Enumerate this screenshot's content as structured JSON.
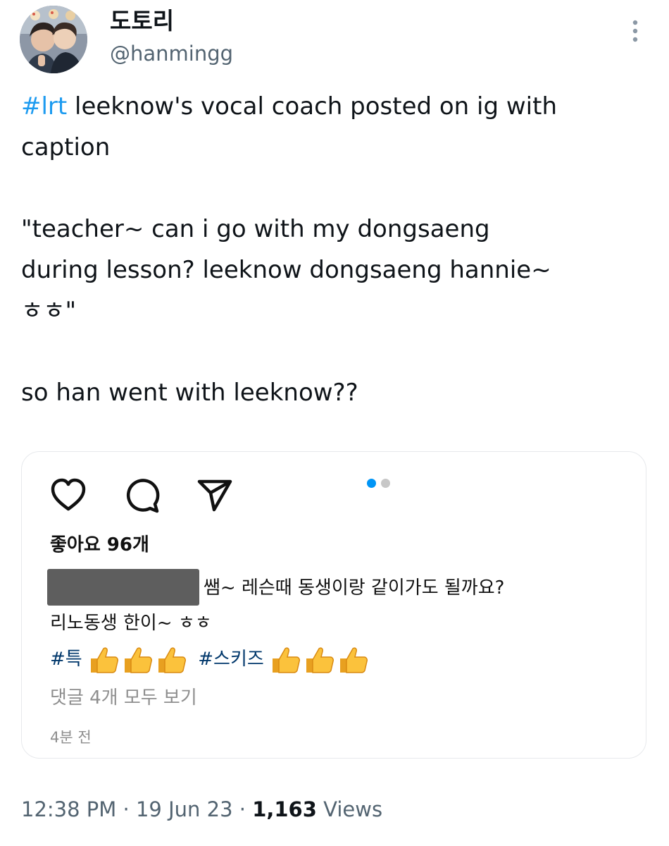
{
  "tweet": {
    "author": {
      "display_name": "도토리",
      "handle": "@hanmingg"
    },
    "text": {
      "hashtag": "#lrt",
      "line1_rest": " leeknow's vocal coach posted on ig with",
      "line2": "caption",
      "quote_line1": "\"teacher~ can i go with my dongsaeng",
      "quote_line2": "during lesson? leeknow dongsaeng hannie~",
      "quote_line3": "ㅎㅎ\"",
      "closing": "so han went with leeknow??"
    },
    "embedded_post": {
      "likes": "좋아요 96개",
      "caption_line1": "쌤~ 레슨때 동생이랑 같이가도 될까요?",
      "caption_line2": "리노동생 한이~ ㅎㅎ",
      "tag1": "#특",
      "tag2": "#스키즈",
      "thumbs_emoji_count": 3,
      "view_comments": "댓글 4개 모두 보기",
      "time_ago": "4분 전",
      "carousel": {
        "total": 2,
        "active": 1
      },
      "icons": [
        "heart-icon",
        "comment-icon",
        "share-icon"
      ]
    },
    "meta": {
      "time": "12:38 PM",
      "separator": " · ",
      "date": "19 Jun 23",
      "views_count": "1,163",
      "views_label": " Views"
    }
  },
  "colors": {
    "link_blue": "#1d9bf0",
    "ig_tag": "#00376b",
    "secondary_text": "#536471",
    "ig_grey_text": "#8e8e8e",
    "carousel_active": "#0095f6",
    "carousel_inactive": "#c7c7c7",
    "redaction": "#5e5e5e"
  }
}
